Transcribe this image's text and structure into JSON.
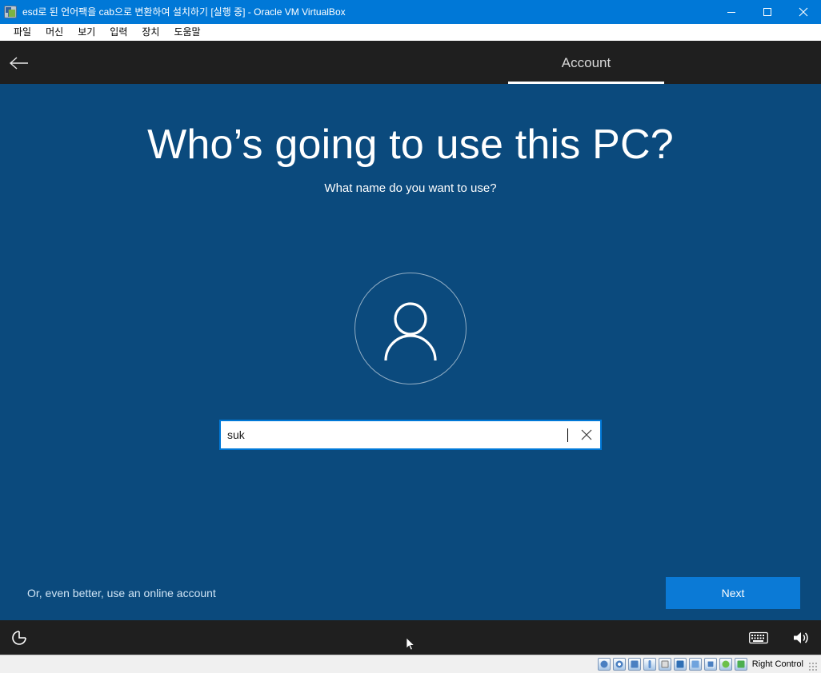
{
  "window": {
    "title": "esd로 된 언어팩을 cab으로 변환하여 설치하기 [실행 중] - Oracle VM VirtualBox",
    "app_icon": "virtualbox-icon",
    "controls": {
      "minimize": "minimize-icon",
      "maximize": "maximize-icon",
      "close": "close-icon"
    },
    "titlebar_color": "#0078d7"
  },
  "menubar": {
    "items": [
      {
        "label": "파일"
      },
      {
        "label": "머신"
      },
      {
        "label": "보기"
      },
      {
        "label": "입력"
      },
      {
        "label": "장치"
      },
      {
        "label": "도움말"
      }
    ]
  },
  "oobe": {
    "background_color": "#0b4a7d",
    "header": {
      "back_icon": "back-arrow-icon",
      "tab_label": "Account",
      "header_color": "#1f1f1f"
    },
    "title": "Who’s going to use this PC?",
    "subtitle": "What name do you want to use?",
    "avatar_icon": "person-avatar-icon",
    "name_field": {
      "value": "suk",
      "placeholder": "",
      "clear_icon": "clear-x-icon",
      "focus_color": "#0078d7"
    },
    "online_account_link": "Or, even better, use an online account",
    "next_button": {
      "label": "Next",
      "color": "#0b7ad6"
    },
    "taskbar": {
      "ease_of_access_icon": "ease-of-access-icon",
      "keyboard_icon": "keyboard-icon",
      "volume_icon": "volume-icon"
    }
  },
  "statusbar": {
    "icons": [
      {
        "name": "hard-disk-icon"
      },
      {
        "name": "optical-disk-icon"
      },
      {
        "name": "network-icon"
      },
      {
        "name": "usb-icon"
      },
      {
        "name": "shared-folders-icon"
      },
      {
        "name": "display-icon"
      },
      {
        "name": "shared-clipboard-icon"
      },
      {
        "name": "recording-icon"
      },
      {
        "name": "guest-additions-icon"
      },
      {
        "name": "mouse-integration-icon"
      }
    ],
    "host_key": "Right Control"
  }
}
